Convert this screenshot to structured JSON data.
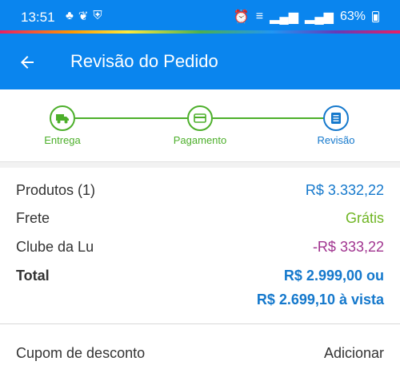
{
  "status_bar": {
    "time": "13:51",
    "left_icons": [
      "notification-icon",
      "notification-icon",
      "shield-icon"
    ],
    "right_icons": [
      "alarm-icon",
      "wifi-icon",
      "signal-icon",
      "signal-icon"
    ],
    "battery": "63%"
  },
  "app_bar": {
    "title": "Revisão do Pedido",
    "back_icon": "arrow-left-icon"
  },
  "stepper": {
    "steps": [
      {
        "label": "Entrega",
        "icon": "truck-icon",
        "state": "done"
      },
      {
        "label": "Pagamento",
        "icon": "credit-card-icon",
        "state": "done"
      },
      {
        "label": "Revisão",
        "icon": "list-icon",
        "state": "current"
      }
    ]
  },
  "summary": {
    "products_label": "Produtos (1)",
    "products_value": "R$ 3.332,22",
    "shipping_label": "Frete",
    "shipping_value": "Grátis",
    "club_label": "Clube da Lu",
    "club_value": "-R$ 333,22",
    "total_label": "Total",
    "total_value_line1": "R$ 2.999,00 ou",
    "total_value_line2": "R$ 2.699,10 à vista"
  },
  "coupon": {
    "label": "Cupom de desconto",
    "action": "Adicionar"
  },
  "colors": {
    "primary": "#0a85ee",
    "step_done": "#4caf2a",
    "step_current": "#1478cc",
    "price_blue": "#1478cc",
    "free_green": "#6fb523",
    "discount_purple": "#a0338f"
  }
}
